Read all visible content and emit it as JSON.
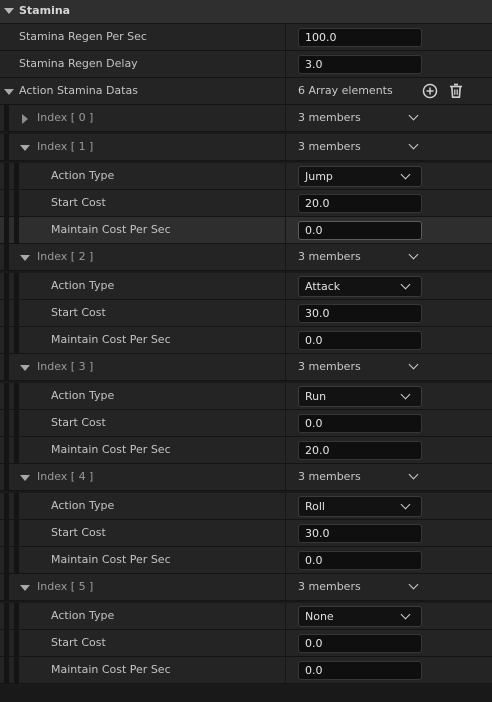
{
  "section": {
    "title": "Stamina"
  },
  "regen": {
    "label": "Stamina Regen Per Sec",
    "value": "100.0"
  },
  "delay": {
    "label": "Stamina Regen Delay",
    "value": "3.0"
  },
  "array": {
    "label": "Action Stamina Datas",
    "count_text": "6 Array elements",
    "add_icon": "add-circle-icon",
    "delete_icon": "trash-icon"
  },
  "field_labels": {
    "action_type": "Action Type",
    "start_cost": "Start Cost",
    "maintain_cost": "Maintain Cost Per Sec"
  },
  "elements": [
    {
      "label": "Index [ 0 ]",
      "members": "3 members",
      "expanded": false
    },
    {
      "label": "Index [ 1 ]",
      "members": "3 members",
      "expanded": true,
      "action_type": "Jump",
      "start_cost": "20.0",
      "maintain_cost": "0.0"
    },
    {
      "label": "Index [ 2 ]",
      "members": "3 members",
      "expanded": true,
      "action_type": "Attack",
      "start_cost": "30.0",
      "maintain_cost": "0.0"
    },
    {
      "label": "Index [ 3 ]",
      "members": "3 members",
      "expanded": true,
      "action_type": "Run",
      "start_cost": "0.0",
      "maintain_cost": "20.0"
    },
    {
      "label": "Index [ 4 ]",
      "members": "3 members",
      "expanded": true,
      "action_type": "Roll",
      "start_cost": "30.0",
      "maintain_cost": "0.0"
    },
    {
      "label": "Index [ 5 ]",
      "members": "3 members",
      "expanded": true,
      "action_type": "None",
      "start_cost": "0.0",
      "maintain_cost": "0.0"
    }
  ],
  "colors": {
    "background": "#242424",
    "input_bg": "#0f0f0f",
    "text": "#c4c4c4"
  }
}
